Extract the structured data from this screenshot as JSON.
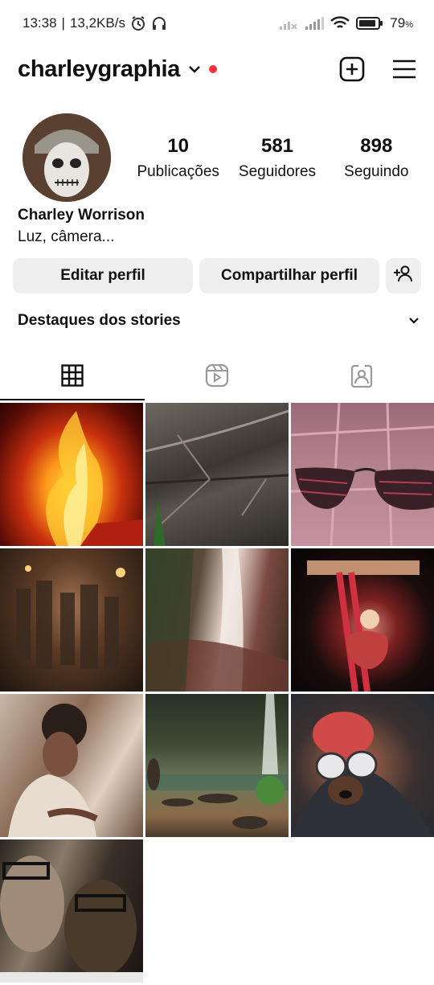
{
  "status_bar": {
    "time": "13:38",
    "speed": "13,2KB/s",
    "battery": "79"
  },
  "header": {
    "username": "charleygraphia"
  },
  "profile": {
    "stats": [
      {
        "value": "10",
        "label": "Publicações"
      },
      {
        "value": "581",
        "label": "Seguidores"
      },
      {
        "value": "898",
        "label": "Seguindo"
      }
    ],
    "name": "Charley Worrison",
    "bio": "Luz, câmera..."
  },
  "buttons": {
    "edit": "Editar perfil",
    "share": "Compartilhar perfil"
  },
  "highlights": {
    "title": "Destaques dos stories"
  },
  "tabs": [
    {
      "icon": "grid-icon",
      "active": true
    },
    {
      "icon": "reels-icon",
      "active": false
    },
    {
      "icon": "tagged-icon",
      "active": false
    }
  ],
  "posts": [
    {
      "icon": "photo-fire"
    },
    {
      "icon": "photo-leaf"
    },
    {
      "icon": "photo-sunglasses"
    },
    {
      "icon": "photo-crowd-night"
    },
    {
      "icon": "photo-waterfall"
    },
    {
      "icon": "photo-aerial-silk"
    },
    {
      "icon": "photo-person-smiling"
    },
    {
      "icon": "photo-river-rocks"
    },
    {
      "icon": "photo-dog-goggles"
    },
    {
      "icon": "photo-two-men"
    }
  ],
  "colors": {
    "accent_dot": "#ff3040",
    "button_bg": "#efefef",
    "text": "#111111"
  }
}
